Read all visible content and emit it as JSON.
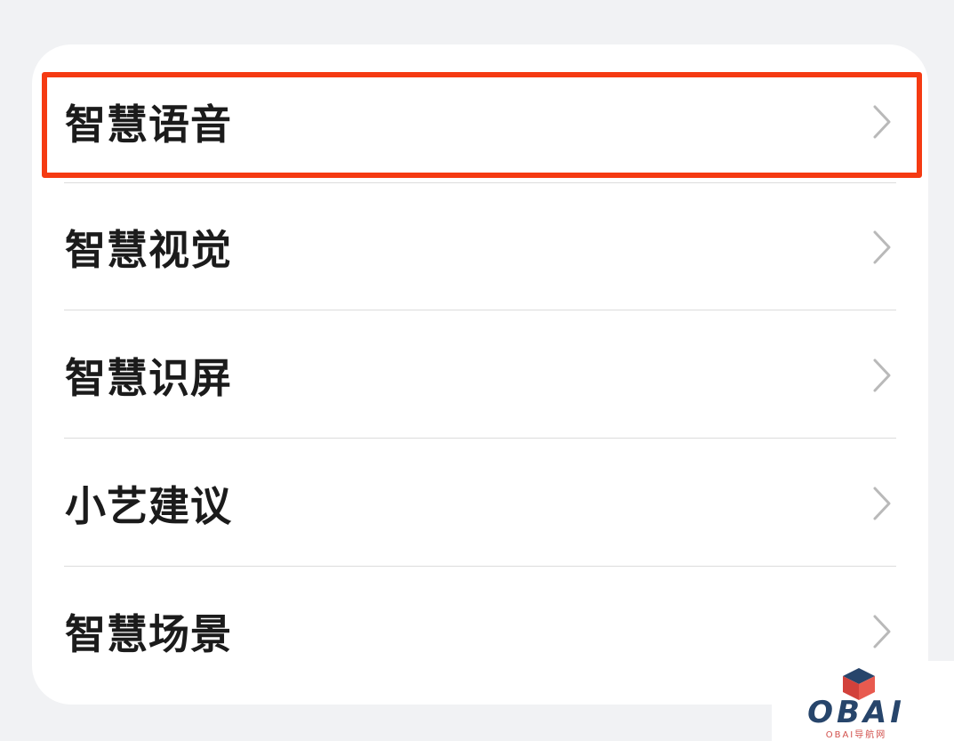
{
  "menu": {
    "items": [
      {
        "label": "智慧语音",
        "icon": "chevron-right-icon"
      },
      {
        "label": "智慧视觉",
        "icon": "chevron-right-icon"
      },
      {
        "label": "智慧识屏",
        "icon": "chevron-right-icon"
      },
      {
        "label": "小艺建议",
        "icon": "chevron-right-icon"
      },
      {
        "label": "智慧场景",
        "icon": "chevron-right-icon"
      }
    ]
  },
  "highlight": {
    "target_index": 0,
    "color": "#f53a12"
  },
  "watermark": {
    "logo_text": "OBAI",
    "subtitle": "OBAI导航网"
  },
  "colors": {
    "background": "#f1f2f4",
    "card": "#ffffff",
    "text": "#1b1b1b",
    "chevron": "#b9b9b9",
    "divider": "#dcdcdc"
  }
}
